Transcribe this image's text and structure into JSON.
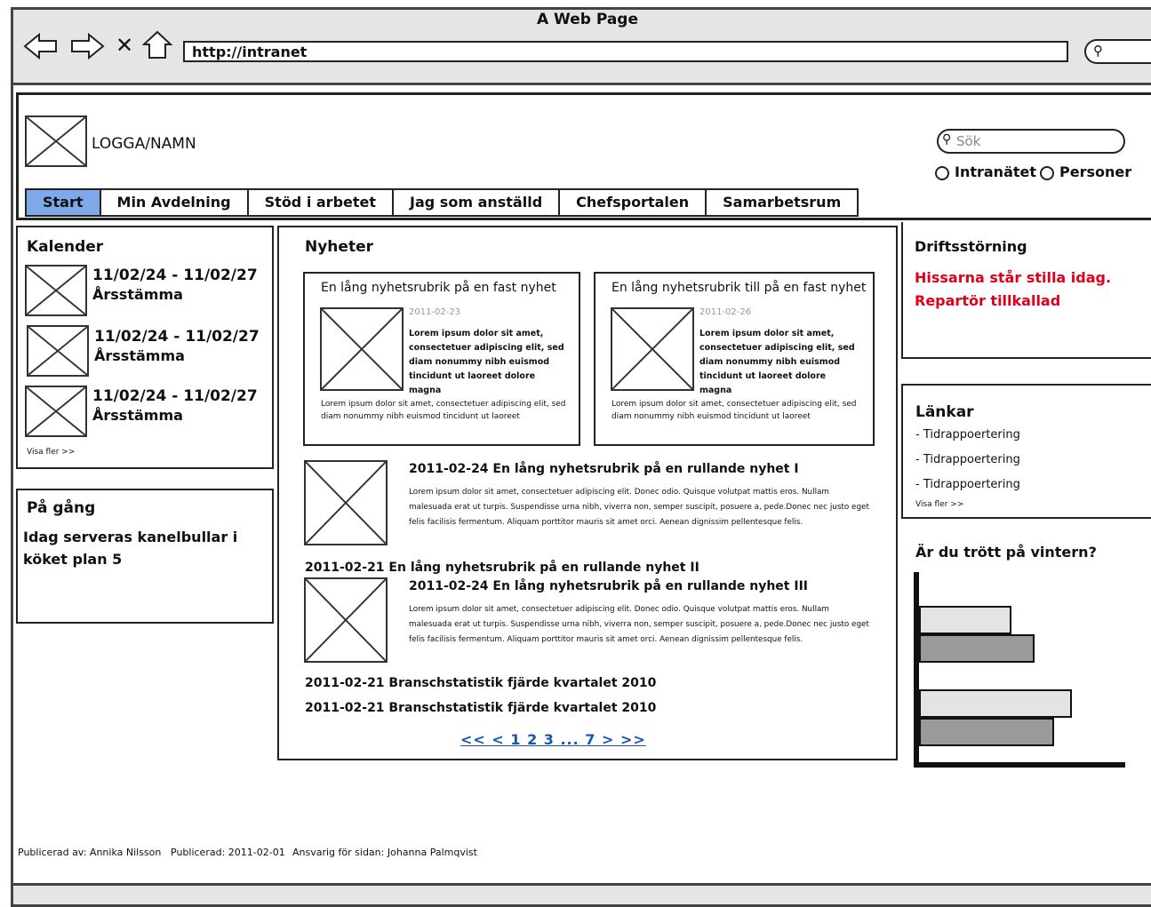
{
  "browser": {
    "title": "A Web Page",
    "url": "http://intranet"
  },
  "logo": {
    "label": "LOGGA/NAMN"
  },
  "search": {
    "placeholder": "Sök",
    "options": [
      "Intranätet",
      "Personer"
    ]
  },
  "nav": {
    "tabs": [
      "Start",
      "Min Avdelning",
      "Stöd i arbetet",
      "Jag som anställd",
      "Chefsportalen",
      "Samarbetsrum"
    ],
    "active": "Start"
  },
  "kalender": {
    "title": "Kalender",
    "items": [
      {
        "date": "11/02/24 - 11/02/27",
        "label": "Årsstämma"
      },
      {
        "date": "11/02/24 - 11/02/27",
        "label": "Årsstämma"
      },
      {
        "date": "11/02/24 - 11/02/27",
        "label": "Årsstämma"
      }
    ],
    "more": "Visa fler >>"
  },
  "pagang": {
    "title": "På gång",
    "text": "Idag serveras kanelbullar i köket plan 5"
  },
  "nyheter": {
    "title": "Nyheter",
    "featured": [
      {
        "title": "En lång nyhetsrubrik på en fast nyhet",
        "date": "2011-02-23",
        "lead": "Lorem ipsum dolor sit amet, consectetuer adipiscing elit, sed diam nonummy nibh euismod tincidunt ut laoreet dolore magna",
        "body": "Lorem ipsum dolor sit amet, consectetuer adipiscing elit, sed diam nonummy nibh euismod tincidunt ut laoreet"
      },
      {
        "title": "En lång nyhetsrubrik till på en fast nyhet",
        "date": "2011-02-26",
        "lead": "Lorem ipsum dolor sit amet, consectetuer adipiscing elit, sed diam nonummy nibh euismod tincidunt ut laoreet dolore magna",
        "body": "Lorem ipsum dolor sit amet, consectetuer adipiscing elit, sed diam nonummy nibh euismod tincidunt ut laoreet"
      }
    ],
    "rolling1": {
      "title": "2011-02-24 En lång nyhetsrubrik på en rullande nyhet I",
      "body": "Lorem ipsum dolor sit amet, consectetuer adipiscing elit. Donec odio. Quisque volutpat mattis eros. Nullam malesuada erat ut turpis. Suspendisse urna nibh, viverra non, semper suscipit, posuere a, pede.Donec nec justo eget felis facilisis fermentum. Aliquam porttitor mauris sit amet orci. Aenean dignissim pellentesque felis."
    },
    "rolling2_line": "2011-02-21 En lång nyhetsrubrik på en rullande nyhet II",
    "rolling3": {
      "title": "2011-02-24 En lång nyhetsrubrik på en rullande nyhet III",
      "body": "Lorem ipsum dolor sit amet, consectetuer adipiscing elit. Donec odio. Quisque volutpat mattis eros. Nullam malesuada erat ut turpis. Suspendisse urna nibh, viverra non, semper suscipit, posuere a, pede.Donec nec justo eget felis facilisis fermentum. Aliquam porttitor mauris sit amet orci. Aenean dignissim pellentesque felis."
    },
    "list": [
      "2011-02-21 Branschstatistik fjärde kvartalet 2010",
      "2011-02-21 Branschstatistik fjärde kvartalet 2010"
    ],
    "pagination": "<< < 1 2 3 ... 7 > >>"
  },
  "drift": {
    "title": "Driftsstörning",
    "text": "Hissarna står stilla idag. Repartör tillkallad",
    "color": "#e0001a"
  },
  "lankar": {
    "title": "Länkar",
    "items": [
      "- Tidrappoertering",
      "- Tidrappoertering",
      "- Tidrappoertering"
    ],
    "more": "Visa fler >>"
  },
  "poll": {
    "title": "Är du trött på vintern?"
  },
  "footer": {
    "publisher": "Publicerad av: Annika Nilsson",
    "published": "Publicerad: 2011-02-01",
    "responsible": "Ansvarig för sidan: Johanna Palmqvist"
  }
}
